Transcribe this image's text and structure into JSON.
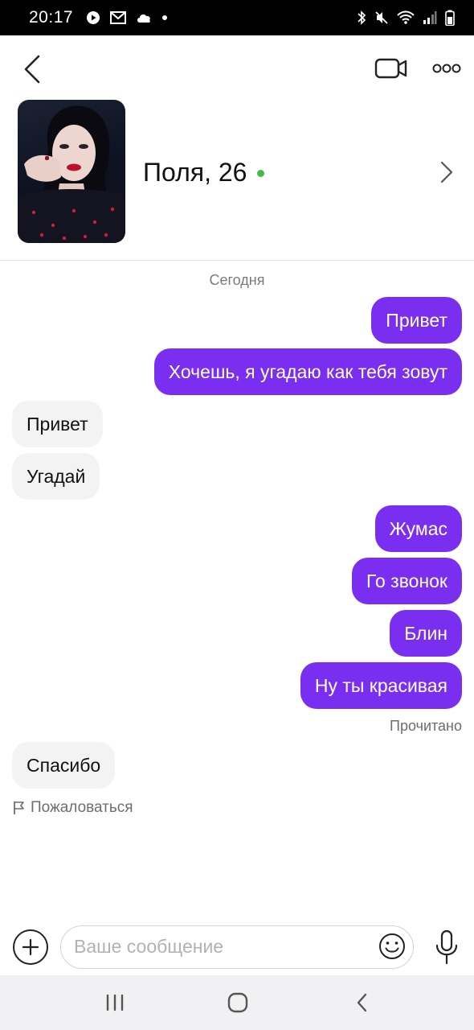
{
  "status_bar": {
    "time": "20:17",
    "left_icons": [
      "youtube-icon",
      "gmail-icon",
      "cloud-icon",
      "dot-icon"
    ],
    "right_icons": [
      "bluetooth-icon",
      "mute-icon",
      "wifi-icon",
      "signal-icon",
      "battery-icon"
    ]
  },
  "header": {
    "icons": {
      "back": "chevron-left-icon",
      "video": "video-camera-icon",
      "more": "more-dots-icon"
    }
  },
  "profile": {
    "name": "Поля, 26",
    "online": true,
    "online_color": "#3fbf4a"
  },
  "chat": {
    "date_label": "Сегодня",
    "messages": [
      {
        "side": "out",
        "text": "Привет"
      },
      {
        "side": "out",
        "text": "Хочешь, я угадаю как тебя зовут"
      },
      {
        "side": "in",
        "text": "Привет"
      },
      {
        "side": "in",
        "text": "Угадай"
      },
      {
        "side": "out",
        "text": "Жумас"
      },
      {
        "side": "out",
        "text": "Го звонок"
      },
      {
        "side": "out",
        "text": "Блин"
      },
      {
        "side": "out",
        "text": "Ну ты красивая"
      },
      {
        "side": "in",
        "text": "Спасибо"
      }
    ],
    "read_status": "Прочитано",
    "report_label": "Пожаловаться"
  },
  "composer": {
    "placeholder": "Ваше сообщение",
    "value": ""
  },
  "colors": {
    "outgoing_bubble": "#7a2ff0",
    "incoming_bubble": "#f3f3f4",
    "nav_bar": "#f1f1f3"
  }
}
